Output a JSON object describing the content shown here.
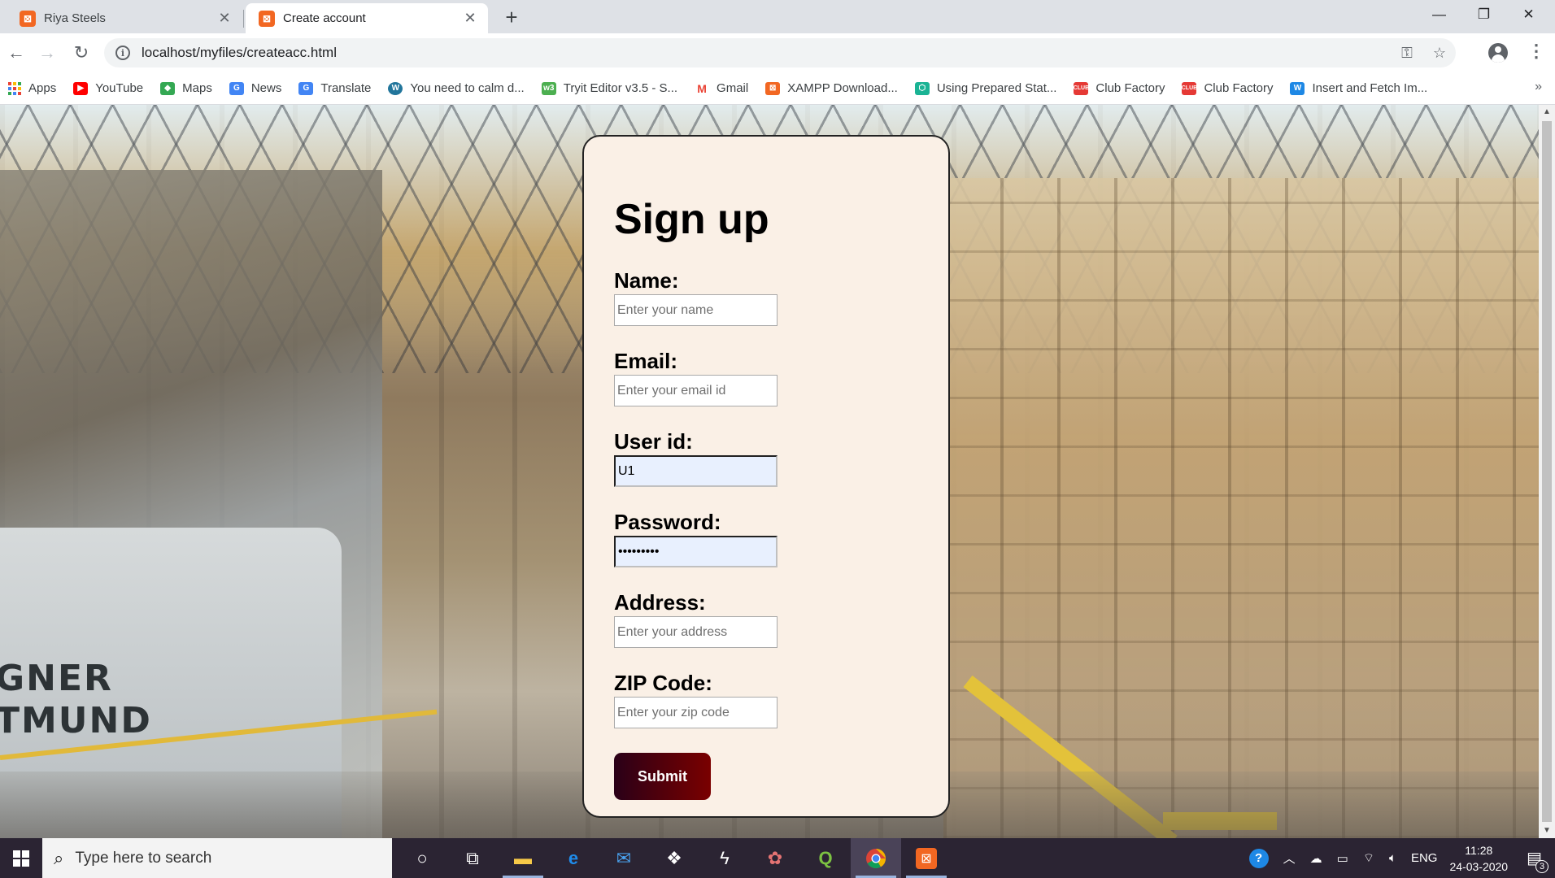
{
  "browser": {
    "tabs": [
      {
        "title": "Riya Steels",
        "active": false
      },
      {
        "title": "Create account",
        "active": true
      }
    ],
    "url": "localhost/myfiles/createacc.html",
    "bookmarks": [
      {
        "label": "Apps",
        "icon": "apps-grid-icon"
      },
      {
        "label": "YouTube",
        "icon": "youtube-icon",
        "color": "#ff0000"
      },
      {
        "label": "Maps",
        "icon": "maps-icon",
        "color": "#34a853"
      },
      {
        "label": "News",
        "icon": "news-icon",
        "color": "#4285f4"
      },
      {
        "label": "Translate",
        "icon": "translate-icon",
        "color": "#4285f4"
      },
      {
        "label": "You need to calm d...",
        "icon": "wordpress-icon",
        "color": "#21759b"
      },
      {
        "label": "Tryit Editor v3.5 - S...",
        "icon": "w3schools-icon",
        "color": "#4caf50"
      },
      {
        "label": "Gmail",
        "icon": "gmail-icon",
        "color": "#ea4335"
      },
      {
        "label": "XAMPP Download...",
        "icon": "xampp-icon",
        "color": "#f26722"
      },
      {
        "label": "Using Prepared Stat...",
        "icon": "hexagon-icon",
        "color": "#1ab394"
      },
      {
        "label": "Club Factory",
        "icon": "clubfactory-icon",
        "color": "#e53935"
      },
      {
        "label": "Club Factory",
        "icon": "clubfactory-icon",
        "color": "#e53935"
      },
      {
        "label": "Insert and Fetch Im...",
        "icon": "w-icon",
        "color": "#1e88e5"
      }
    ]
  },
  "form": {
    "heading": "Sign up",
    "fields": [
      {
        "label": "Name:",
        "placeholder": "Enter your name",
        "value": ""
      },
      {
        "label": "Email:",
        "placeholder": "Enter your email id",
        "value": ""
      },
      {
        "label": "User id:",
        "placeholder": "",
        "value": "U1"
      },
      {
        "label": "Password:",
        "placeholder": "",
        "value": "•••••••••"
      },
      {
        "label": "Address:",
        "placeholder": "Enter your address",
        "value": ""
      },
      {
        "label": "ZIP Code:",
        "placeholder": "Enter your zip code",
        "value": ""
      }
    ],
    "submit_label": "Submit",
    "colors": {
      "card_bg": "#faf0e6",
      "button_from": "#2a0018",
      "button_to": "#7a0000"
    }
  },
  "background": {
    "machine_text_line1": "GNER",
    "machine_text_line2": "TMUND"
  },
  "taskbar": {
    "search_placeholder": "Type here to search",
    "language": "ENG",
    "time": "11:28",
    "date": "24-03-2020",
    "notification_count": "3"
  }
}
